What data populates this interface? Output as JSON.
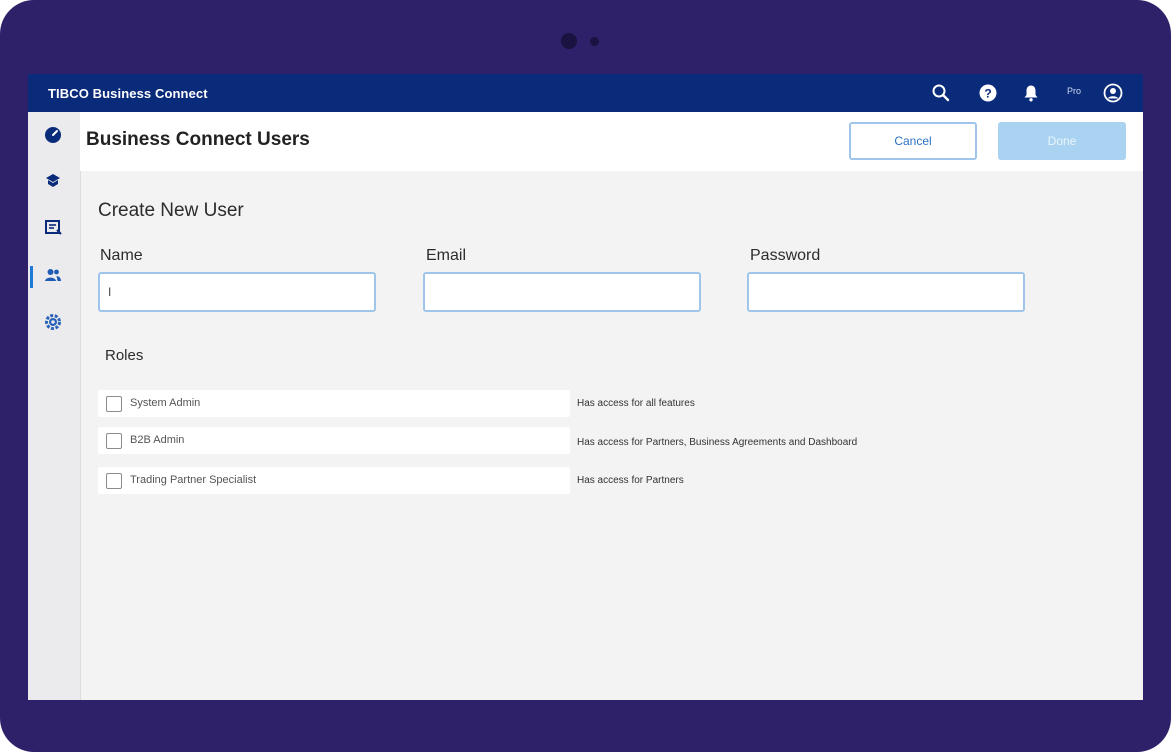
{
  "app": {
    "title": "TIBCO Business Connect",
    "user_initials": "Pro"
  },
  "header": {
    "page_title": "Business Connect Users",
    "cancel_label": "Cancel",
    "done_label": "Done"
  },
  "sidebar": {
    "items": [
      {
        "icon": "dashboard-icon"
      },
      {
        "icon": "partners-icon"
      },
      {
        "icon": "agreements-icon"
      },
      {
        "icon": "users-icon",
        "active": true
      },
      {
        "icon": "settings-icon"
      }
    ]
  },
  "form": {
    "title": "Create New User",
    "name_label": "Name",
    "name_value": "I",
    "email_label": "Email",
    "email_value": "",
    "password_label": "Password",
    "password_value": "",
    "roles_label": "Roles",
    "roles": [
      {
        "name": "System Admin",
        "description": "Has access for all features",
        "checked": false
      },
      {
        "name": "B2B Admin",
        "description": "Has access for Partners, Business Agreements and Dashboard",
        "checked": false
      },
      {
        "name": "Trading Partner Specialist",
        "description": "Has access for Partners",
        "checked": false
      }
    ]
  },
  "colors": {
    "device_frame": "#2e2169",
    "topbar": "#0a2a7a",
    "accent": "#1f7ad6",
    "input_border": "#9fc6ea",
    "done_disabled": "#a9d3f0"
  }
}
